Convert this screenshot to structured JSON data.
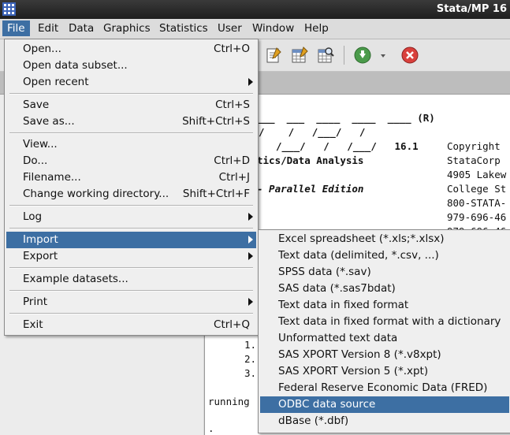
{
  "window": {
    "title": "Stata/MP 16"
  },
  "menubar": {
    "items": [
      "File",
      "Edit",
      "Data",
      "Graphics",
      "Statistics",
      "User",
      "Window",
      "Help"
    ]
  },
  "toolbar": {
    "icons": [
      "do-file-editor-icon",
      "data-editor-icon",
      "data-browser-icon",
      "continue-icon",
      "break-icon"
    ]
  },
  "file_menu": {
    "open": {
      "label": "Open...",
      "shortcut": "Ctrl+O"
    },
    "open_subset": {
      "label": "Open data subset..."
    },
    "open_recent": {
      "label": "Open recent"
    },
    "save": {
      "label": "Save",
      "shortcut": "Ctrl+S"
    },
    "save_as": {
      "label": "Save as...",
      "shortcut": "Shift+Ctrl+S"
    },
    "view": {
      "label": "View..."
    },
    "do": {
      "label": "Do...",
      "shortcut": "Ctrl+D"
    },
    "filename": {
      "label": "Filename...",
      "shortcut": "Ctrl+J"
    },
    "change_dir": {
      "label": "Change working directory...",
      "shortcut": "Shift+Ctrl+F"
    },
    "log": {
      "label": "Log"
    },
    "import": {
      "label": "Import"
    },
    "export": {
      "label": "Export"
    },
    "example": {
      "label": "Example datasets..."
    },
    "print": {
      "label": "Print"
    },
    "exit": {
      "label": "Exit",
      "shortcut": "Ctrl+Q"
    }
  },
  "import_menu": {
    "items": [
      "Excel spreadsheet (*.xls;*.xlsx)",
      "Text data (delimited, *.csv, ...)",
      "SPSS data (*.sav)",
      "SAS data (*.sas7bdat)",
      "Text data in fixed format",
      "Text data in fixed format with a dictionary",
      "Unformatted text data",
      "SAS XPORT Version 8 (*.v8xpt)",
      "SAS XPORT Version 5 (*.xpt)",
      "Federal Reserve Economic Data (FRED)",
      "ODBC data source",
      "dBase (*.dbf)"
    ],
    "highlighted": "ODBC data source"
  },
  "results": {
    "logo_line1": "___  ___  ____  ____  ____ (R)",
    "logo_line2": "/    /   /___/   /",
    "logo_line3": "/___/   /   /___/   16.1",
    "stats_text": "tics/Data Analysis",
    "edition": "- Parallel Edition",
    "copyright": "Copyright",
    "company": "StataCorp",
    "address": "4905 Lakew",
    "city": "College St",
    "phone1": "800-STATA-",
    "phone2": "979-696-46",
    "phone3": "979-696-46",
    "n1": "1.",
    "n2": "2.",
    "n3": "3.",
    "running": "running",
    "dot": "."
  },
  "colors": {
    "highlight": "#3d6fa3",
    "titlebar": "#2a2a2a"
  }
}
